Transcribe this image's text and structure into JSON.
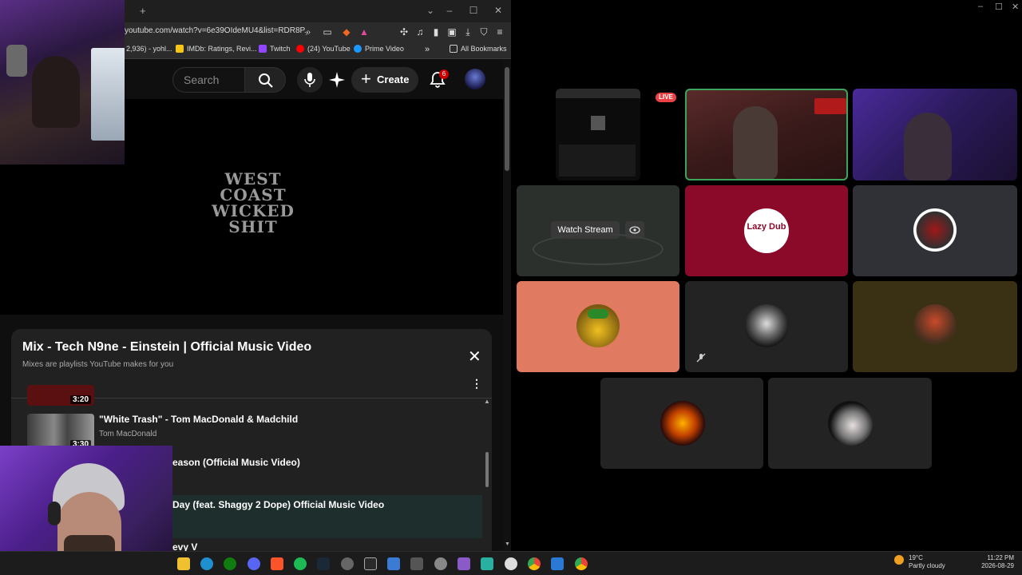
{
  "browser": {
    "url": "youtube.com/watch?v=6e39OIdeMU4&list=RDR8P...",
    "bookmarks": [
      {
        "label": "2,936) - yohl..."
      },
      {
        "label": "IMDb: Ratings, Revi..."
      },
      {
        "label": "Twitch"
      },
      {
        "label": "(24) YouTube"
      },
      {
        "label": "Prime Video"
      },
      {
        "label": "All Bookmarks"
      }
    ]
  },
  "youtube": {
    "search_placeholder": "Search",
    "create_label": "Create",
    "notification_count": "6",
    "video_title_art": "WEST COAST WICKED SHIT"
  },
  "playlist": {
    "title": "Mix - Tech N9ne - Einstein | Official Music Video",
    "subtitle": "Mixes are playlists YouTube makes for you",
    "items": [
      {
        "duration": "3:20"
      },
      {
        "title": "\"White Trash\" - Tom MacDonald & Madchild",
        "channel": "Tom MacDonald",
        "duration": "3:30"
      },
      {
        "title": "eason (Official Music Video)"
      },
      {
        "title": "Day (feat. Shaggy 2 Dope) Official Music Video"
      },
      {
        "title": "evy V"
      }
    ]
  },
  "discord": {
    "live_label": "LIVE",
    "watch_stream_label": "Watch Stream",
    "tile_colors": {
      "lazy_dub": "#8b0a2a",
      "bee": "#e07a60",
      "gold_bg": "#3a3014",
      "dark": "#232323",
      "grey": "#2f3136"
    },
    "lazy_dub_text": "Lazy Dub"
  },
  "taskbar": {
    "weather_temp": "19°C",
    "weather_desc": "Partly cloudy",
    "time": "11:22 PM",
    "date": "2026-08-29"
  }
}
